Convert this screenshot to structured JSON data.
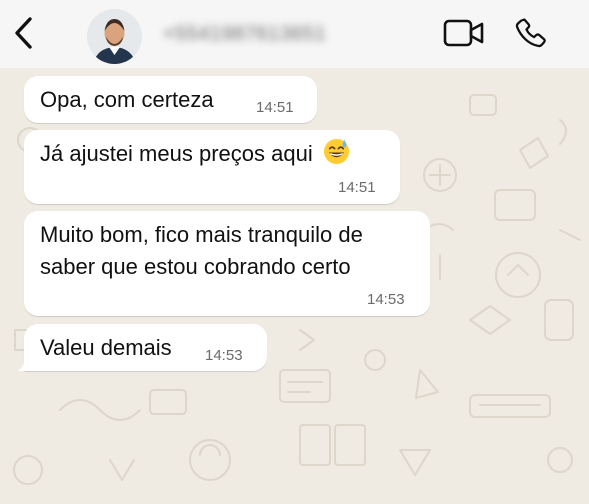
{
  "header": {
    "back_icon": "chevron-left-icon",
    "contact_name": "+5541987613651",
    "video_icon": "video-camera-icon",
    "call_icon": "phone-icon"
  },
  "messages": [
    {
      "text": "Opa, com certeza",
      "time": "14:51",
      "direction": "incoming"
    },
    {
      "text": "Já ajustei meus preços aqui",
      "emoji": "grinning-face-with-sweat",
      "time": "14:51",
      "direction": "incoming"
    },
    {
      "text_line1": "Muito bom, fico mais tranquilo de",
      "text_line2": "saber que estou cobrando certo",
      "time": "14:53",
      "direction": "incoming"
    },
    {
      "text": "Valeu demais",
      "time": "14:53",
      "direction": "incoming"
    }
  ],
  "colors": {
    "wallpaper": "#efeae2",
    "bubble": "#ffffff",
    "header": "#f6f6f6",
    "time_text": "#6b6b6b"
  }
}
